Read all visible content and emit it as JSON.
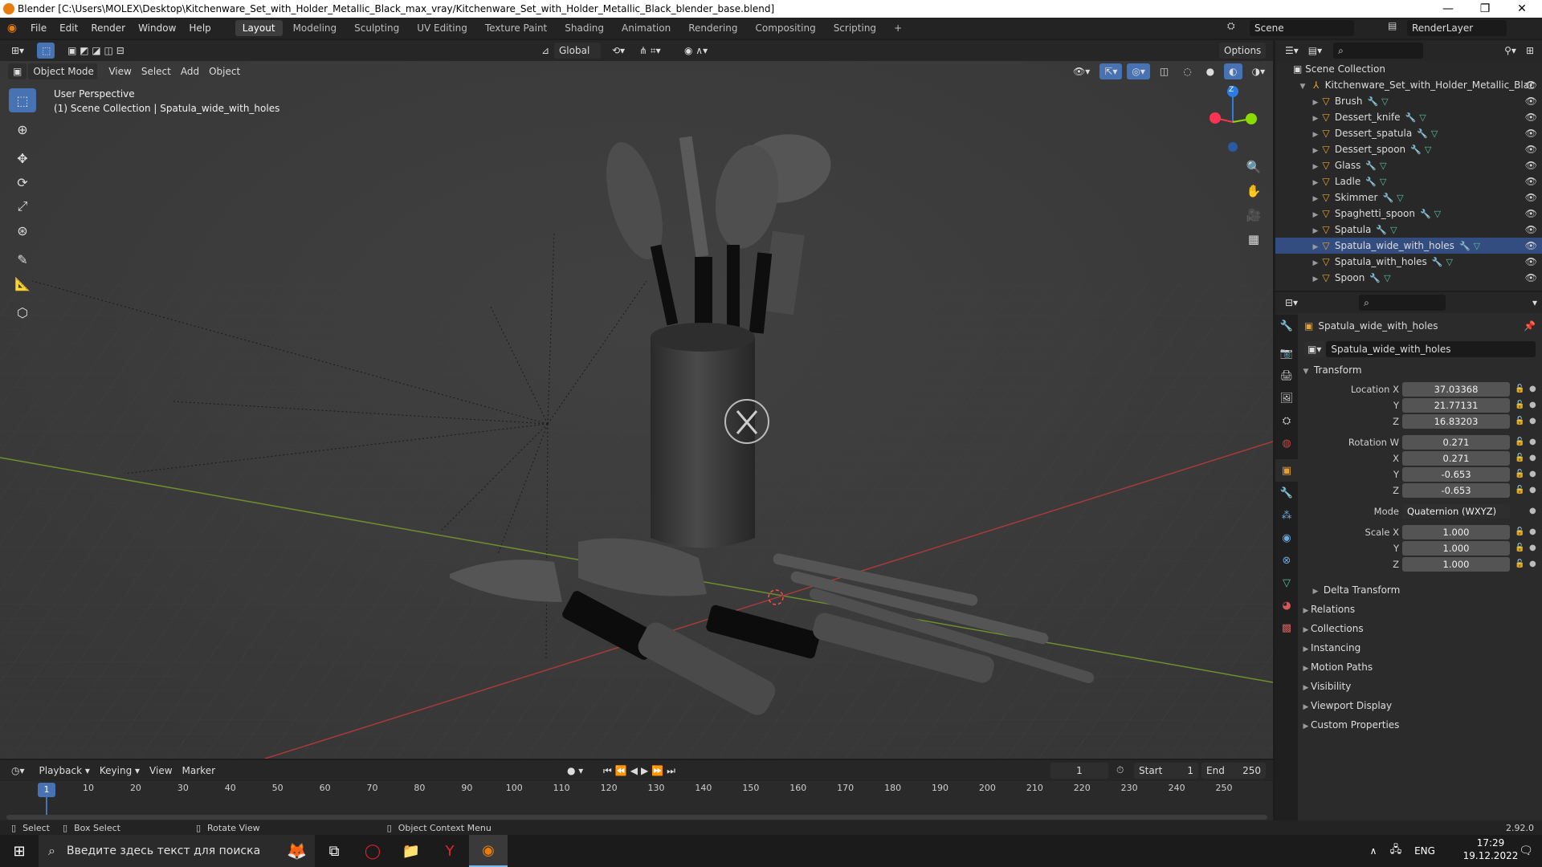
{
  "window": {
    "title": "Blender [C:\\Users\\MOLEX\\Desktop\\Kitchenware_Set_with_Holder_Metallic_Black_max_vray/Kitchenware_Set_with_Holder_Metallic_Black_blender_base.blend]",
    "minimize": "—",
    "maximize": "❐",
    "close": "✕"
  },
  "menu": {
    "items": [
      "File",
      "Edit",
      "Render",
      "Window",
      "Help"
    ],
    "workspaces": [
      "Layout",
      "Modeling",
      "Sculpting",
      "UV Editing",
      "Texture Paint",
      "Shading",
      "Animation",
      "Rendering",
      "Compositing",
      "Scripting"
    ],
    "active_workspace": "Layout",
    "add_workspace": "+",
    "scene": "Scene",
    "render_layer": "RenderLayer"
  },
  "viewport_header": {
    "mode": "Object Mode",
    "menus": [
      "View",
      "Select",
      "Add",
      "Object"
    ],
    "orientation": "Global",
    "options": "Options"
  },
  "viewport": {
    "perspective": "User Perspective",
    "collection_info": "(1) Scene Collection | Spatula_wide_with_holes",
    "gizmo_z": "Z"
  },
  "outliner": {
    "search_placeholder": "",
    "root": "Scene Collection",
    "collection": "Kitchenware_Set_with_Holder_Metallic_Blac",
    "items": [
      {
        "name": "Brush",
        "selected": false
      },
      {
        "name": "Dessert_knife",
        "selected": false
      },
      {
        "name": "Dessert_spatula",
        "selected": false
      },
      {
        "name": "Dessert_spoon",
        "selected": false
      },
      {
        "name": "Glass",
        "selected": false
      },
      {
        "name": "Ladle",
        "selected": false
      },
      {
        "name": "Skimmer",
        "selected": false
      },
      {
        "name": "Spaghetti_spoon",
        "selected": false
      },
      {
        "name": "Spatula",
        "selected": false
      },
      {
        "name": "Spatula_wide_with_holes",
        "selected": true
      },
      {
        "name": "Spatula_with_holes",
        "selected": false
      },
      {
        "name": "Spoon",
        "selected": false
      }
    ]
  },
  "properties": {
    "object_name": "Spatula_wide_with_holes",
    "object_field": "Spatula_wide_with_holes",
    "transform_label": "Transform",
    "location": {
      "label_x": "Location X",
      "label_y": "Y",
      "label_z": "Z",
      "x": "37.03368",
      "y": "21.77131",
      "z": "16.83203"
    },
    "rotation": {
      "label_w": "Rotation W",
      "label_x": "X",
      "label_y": "Y",
      "label_z": "Z",
      "w": "0.271",
      "x": "0.271",
      "y": "-0.653",
      "z": "-0.653"
    },
    "mode": {
      "label": "Mode",
      "value": "Quaternion (WXYZ)"
    },
    "scale": {
      "label_x": "Scale X",
      "label_y": "Y",
      "label_z": "Z",
      "x": "1.000",
      "y": "1.000",
      "z": "1.000"
    },
    "delta_transform": "Delta Transform",
    "panels": [
      "Relations",
      "Collections",
      "Instancing",
      "Motion Paths",
      "Visibility",
      "Viewport Display",
      "Custom Properties"
    ]
  },
  "timeline": {
    "menus": [
      "Playback",
      "Keying",
      "View",
      "Marker"
    ],
    "current_frame": "1",
    "start_label": "Start",
    "start": "1",
    "end_label": "End",
    "end": "250",
    "ticks": [
      "10",
      "20",
      "30",
      "40",
      "50",
      "60",
      "70",
      "80",
      "90",
      "100",
      "110",
      "120",
      "130",
      "140",
      "150",
      "160",
      "170",
      "180",
      "190",
      "200",
      "210",
      "220",
      "230",
      "240",
      "250"
    ],
    "playhead": "1"
  },
  "statusbar": {
    "select": "Select",
    "box_select": "Box Select",
    "rotate_view": "Rotate View",
    "context_menu": "Object Context Menu",
    "version": "2.92.0"
  },
  "taskbar": {
    "search_placeholder": "Введите здесь текст для поиска",
    "lang": "ENG",
    "time": "17:29",
    "date": "19.12.2022"
  },
  "colors": {
    "accent": "#4772b3",
    "selection": "#334d80",
    "object_orange": "#e7a12e",
    "x_axis": "#ff3352",
    "y_axis": "#8bdc00",
    "z_axis": "#2b7de6"
  }
}
